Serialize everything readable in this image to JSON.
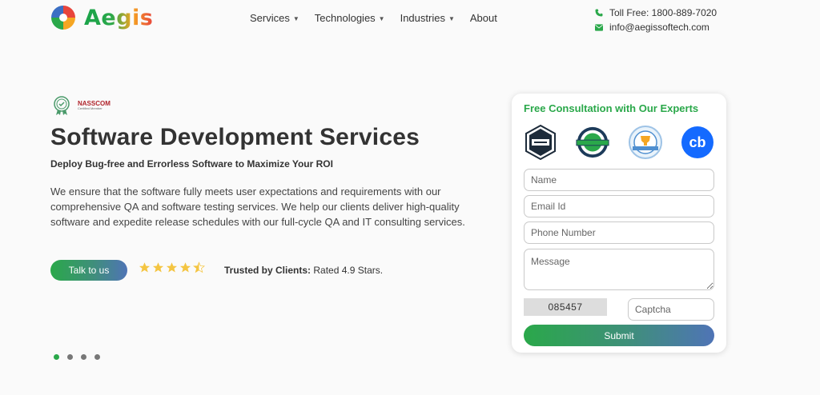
{
  "brand": {
    "name": "Aegis"
  },
  "nav": {
    "items": [
      {
        "label": "Services",
        "dropdown": true
      },
      {
        "label": "Technologies",
        "dropdown": true
      },
      {
        "label": "Industries",
        "dropdown": true
      },
      {
        "label": "About",
        "dropdown": false
      }
    ]
  },
  "contact": {
    "phone": "Toll Free: 1800-889-7020",
    "email": "info@aegissoftech.com",
    "icon_color": "#2aa84a"
  },
  "hero": {
    "badge_title": "NASSCOM",
    "badge_sub": "Certified Member",
    "title": "Software Development Services",
    "subtitle": "Deploy Bug-free and Errorless Software to Maximize Your ROI",
    "description": "We ensure that the software fully meets user expectations and requirements with our comprehensive QA and software testing services. We help our clients deliver high-quality software and expedite release schedules with our full-cycle QA and IT consulting services.",
    "cta_label": "Talk to us",
    "rating": 4.5,
    "trusted_label": "Trusted by Clients:",
    "trusted_value": "Rated 4.9 Stars."
  },
  "carousel": {
    "slides": 4,
    "active": 0
  },
  "form": {
    "title": "Free Consultation with Our Experts",
    "badges": [
      "clutch-badge-icon",
      "goodfirms-badge-icon",
      "awards-badge-icon",
      "crunchbase-badge-icon"
    ],
    "name_placeholder": "Name",
    "email_placeholder": "Email Id",
    "phone_placeholder": "Phone Number",
    "message_placeholder": "Message",
    "captcha_code": "085457",
    "captcha_placeholder": "Captcha",
    "submit_label": "Submit"
  },
  "colors": {
    "accent_green": "#2aa84a",
    "accent_blue": "#4f74b6",
    "text": "#333333"
  }
}
